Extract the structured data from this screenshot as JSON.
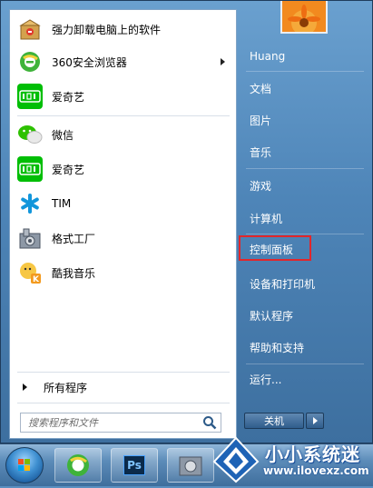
{
  "programs": [
    {
      "label": "强力卸载电脑上的软件",
      "icon": "uninstaller-box-icon",
      "submenu": false
    },
    {
      "label": "360安全浏览器",
      "icon": "360-browser-icon",
      "submenu": true
    },
    {
      "label": "爱奇艺",
      "icon": "iqiyi-icon",
      "submenu": false
    }
  ],
  "recent_programs": [
    {
      "label": "微信",
      "icon": "wechat-icon"
    },
    {
      "label": "爱奇艺",
      "icon": "iqiyi-icon"
    },
    {
      "label": "TIM",
      "icon": "tim-icon"
    },
    {
      "label": "格式工厂",
      "icon": "format-factory-icon"
    },
    {
      "label": "酷我音乐",
      "icon": "kuwo-music-icon"
    }
  ],
  "all_programs_label": "所有程序",
  "search": {
    "placeholder": "搜索程序和文件"
  },
  "right_items": [
    {
      "label": "Huang"
    },
    {
      "label": "文档"
    },
    {
      "label": "图片"
    },
    {
      "label": "音乐"
    },
    {
      "label": "游戏"
    },
    {
      "label": "计算机"
    },
    {
      "label": "控制面板"
    },
    {
      "label": "设备和打印机"
    },
    {
      "label": "默认程序"
    },
    {
      "label": "帮助和支持"
    },
    {
      "label": "运行..."
    }
  ],
  "shutdown_label": "关机",
  "taskbar": {
    "ps_label": "Ps"
  },
  "watermark": {
    "title": "小小系统迷",
    "url": "www.ilovexz.com"
  },
  "colors": {
    "iqiyi": "#00be06",
    "wechat": "#2dc100",
    "highlight": "#e2262b"
  }
}
